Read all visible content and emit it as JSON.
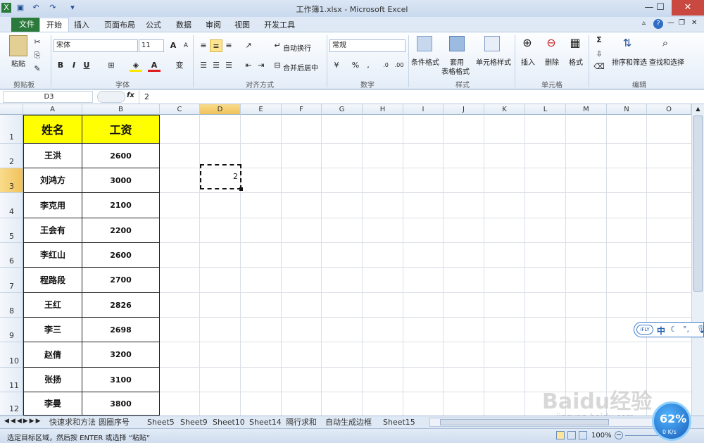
{
  "window": {
    "title": "工作簿1.xlsx - Microsoft Excel"
  },
  "tabs": {
    "file": "文件",
    "items": [
      "开始",
      "插入",
      "页面布局",
      "公式",
      "数据",
      "审阅",
      "视图",
      "开发工具"
    ]
  },
  "ribbon": {
    "clipboard": {
      "paste": "粘贴",
      "label": "剪贴板"
    },
    "font": {
      "name": "宋体",
      "size": "11",
      "bold": "B",
      "italic": "I",
      "underline": "U",
      "label": "字体",
      "grow": "A",
      "shrink": "A",
      "color": "A",
      "wen": "变"
    },
    "align": {
      "wrap": "自动换行",
      "merge": "合并后居中",
      "label": "对齐方式"
    },
    "number": {
      "format": "常规",
      "percent": "%",
      "comma": ",",
      "label": "数字"
    },
    "styles": {
      "cond": "条件格式",
      "table1": "套用",
      "table2": "表格格式",
      "cell": "单元格样式",
      "label": "样式"
    },
    "cells": {
      "insert": "插入",
      "delete": "删除",
      "format": "格式",
      "label": "单元格"
    },
    "edit": {
      "sum": "Σ",
      "sort": "排序和筛选",
      "find": "查找和选择",
      "label": "编辑"
    }
  },
  "formula": {
    "namebox": "D3",
    "fx": "fx",
    "value": "2"
  },
  "grid": {
    "columns": [
      "A",
      "B",
      "C",
      "D",
      "E",
      "F",
      "G",
      "H",
      "I",
      "J",
      "K",
      "L",
      "M",
      "N",
      "O"
    ],
    "rows": [
      "1",
      "2",
      "3",
      "4",
      "5",
      "6",
      "7",
      "8",
      "9",
      "10",
      "11",
      "12"
    ],
    "header": {
      "name": "姓名",
      "salary": "工资"
    },
    "records": [
      {
        "name": "王洪",
        "salary": "2600"
      },
      {
        "name": "刘鸿方",
        "salary": "3000"
      },
      {
        "name": "李克用",
        "salary": "2100"
      },
      {
        "name": "王会有",
        "salary": "2200"
      },
      {
        "name": "李红山",
        "salary": "2600"
      },
      {
        "name": "程路段",
        "salary": "2700"
      },
      {
        "name": "王红",
        "salary": "2826"
      },
      {
        "name": "李三",
        "salary": "2698"
      },
      {
        "name": "赵倩",
        "salary": "3200"
      },
      {
        "name": "张扬",
        "salary": "3100"
      },
      {
        "name": "李曼",
        "salary": "3800"
      }
    ],
    "d3": "2"
  },
  "sheets": [
    "快速求和方法",
    "圆圈序号",
    "Sheet5",
    "Sheet9",
    "Sheet10",
    "Sheet14",
    "隔行求和",
    "自动生成边框",
    "Sheet15"
  ],
  "status": {
    "text": "选定目标区域，然后按 ENTER 或选择 “粘贴”",
    "zoom": "100%"
  },
  "overlay": {
    "ifly": "iFLY",
    "zh": "中",
    "percent": "62%",
    "speed": "0 K/s",
    "watermark": "Baidu经验",
    "url": "jingyan.baidu.com"
  },
  "colors": {
    "header_fill": "#ffff00",
    "file_tab": "#2a7a3b",
    "accent": "#1f4e9a"
  }
}
